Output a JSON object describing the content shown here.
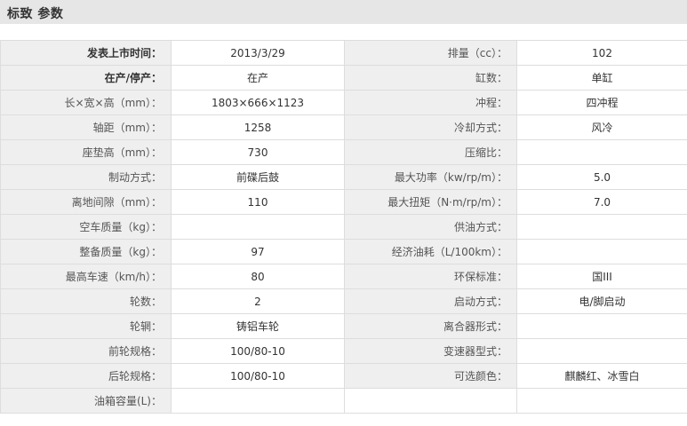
{
  "header": {
    "title": "标致 参数"
  },
  "rows": [
    {
      "l1": "发表上市时间：",
      "v1": "2013/3/29",
      "l2": "排量（cc）：",
      "v2": "102"
    },
    {
      "l1": "在产/停产：",
      "v1": "在产",
      "l2": "缸数：",
      "v2": "单缸"
    },
    {
      "l1": "长×宽×高（mm）：",
      "v1": "1803×666×1123",
      "l2": "冲程：",
      "v2": "四冲程"
    },
    {
      "l1": "轴距（mm）：",
      "v1": "1258",
      "l2": "冷却方式：",
      "v2": "风冷"
    },
    {
      "l1": "座垫高（mm）：",
      "v1": "730",
      "l2": "压缩比：",
      "v2": ""
    },
    {
      "l1": "制动方式：",
      "v1": "前碟后鼓",
      "l2": "最大功率（kw/rp/m）：",
      "v2": "5.0"
    },
    {
      "l1": "离地间隙（mm）：",
      "v1": "110",
      "l2": "最大扭矩（N·m/rp/m）：",
      "v2": "7.0"
    },
    {
      "l1": "空车质量（kg）：",
      "v1": "",
      "l2": "供油方式：",
      "v2": ""
    },
    {
      "l1": "整备质量（kg）：",
      "v1": "97",
      "l2": "经济油耗（L/100km）：",
      "v2": ""
    },
    {
      "l1": "最高车速（km/h）：",
      "v1": "80",
      "l2": "环保标准：",
      "v2": "国III"
    },
    {
      "l1": "轮数：",
      "v1": "2",
      "l2": "启动方式：",
      "v2": "电/脚启动"
    },
    {
      "l1": "轮辋：",
      "v1": "铸铝车轮",
      "l2": "离合器形式：",
      "v2": ""
    },
    {
      "l1": "前轮规格：",
      "v1": "100/80-10",
      "l2": "变速器型式：",
      "v2": ""
    },
    {
      "l1": "后轮规格：",
      "v1": "100/80-10",
      "l2": "可选颜色：",
      "v2": "麒麟红、冰雪白"
    },
    {
      "l1": "油箱容量(L)：",
      "v1": "",
      "l2": "",
      "v2": ""
    }
  ]
}
